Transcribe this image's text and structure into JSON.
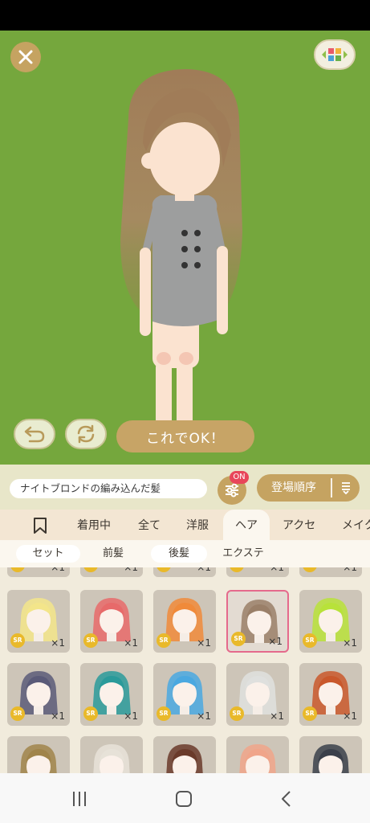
{
  "stage": {
    "background": "#75a73d",
    "ok_label": "これでOK！",
    "close_icon": "close-icon",
    "layout_icon": "layout-toggle-icon",
    "undo_icon": "undo-icon",
    "refresh_icon": "refresh-icon"
  },
  "filterbar": {
    "item_name": "ナイトブロンドの編み込んだ髪",
    "filter_badge": "ON",
    "sort_label": "登場順序",
    "filter_icon": "sliders-icon",
    "sort_icon": "sort-order-icon"
  },
  "categories": {
    "bookmark_icon": "bookmark-icon",
    "items": [
      "着用中",
      "全て",
      "洋服",
      "ヘア",
      "アクセ",
      "メイク"
    ],
    "active": "ヘア"
  },
  "subcategories": {
    "items": [
      "セット",
      "前髪",
      "後髪",
      "エクステ"
    ],
    "active": "セット"
  },
  "items": {
    "rarity": "SR",
    "quantity": "×1",
    "rows": [
      [
        "#f3e58a",
        "#e76a6a",
        "#f08a3a",
        "#9a7f68",
        "#b8e23a"
      ],
      [
        "#5a5a78",
        "#2a9a9a",
        "#4aa8e0",
        "#dfe0de",
        "#c9582c"
      ],
      [
        "#a0844a",
        "#e7e2d8",
        "#6a3a2a",
        "#f0a58a",
        "#3a3f4a"
      ]
    ]
  },
  "navbar": {
    "recents_icon": "recent-apps-icon",
    "home_icon": "home-icon",
    "back_icon": "back-icon"
  }
}
